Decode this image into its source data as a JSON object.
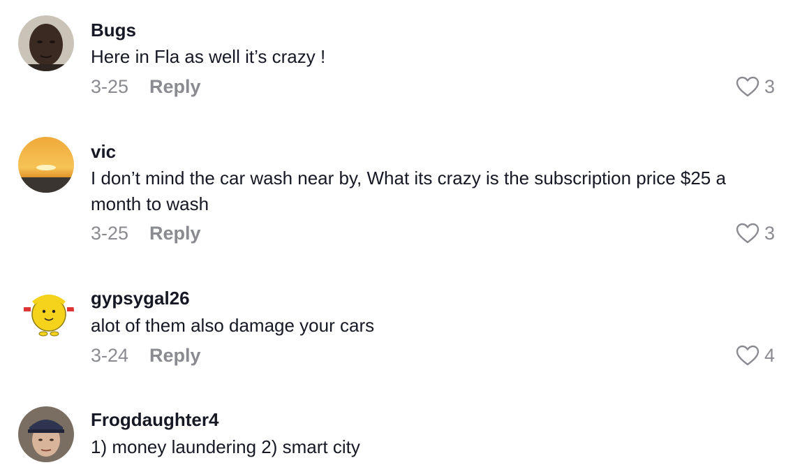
{
  "comments": [
    {
      "username": "Bugs",
      "text": "Here in Fla as well it’s crazy !",
      "date": "3-25",
      "reply_label": "Reply",
      "likes": "3",
      "avatar_icon": "user-avatar-photo"
    },
    {
      "username": "vic",
      "text": "I don’t mind the car wash near by, What its crazy is the subscription price $25 a month to wash",
      "date": "3-25",
      "reply_label": "Reply",
      "likes": "3",
      "avatar_icon": "sunset-photo-avatar"
    },
    {
      "username": "gypsygal26",
      "text": "alot of them also damage your cars",
      "date": "3-24",
      "reply_label": "Reply",
      "likes": "4",
      "avatar_icon": "cartoon-character-avatar"
    },
    {
      "username": "Frogdaughter4",
      "text": "1) money laundering 2) smart city",
      "avatar_icon": "user-avatar-photo"
    }
  ],
  "colors": {
    "text": "#161823",
    "secondary": "#8a8b91",
    "background": "#ffffff"
  },
  "icons": {
    "like": "heart-outline-icon"
  }
}
